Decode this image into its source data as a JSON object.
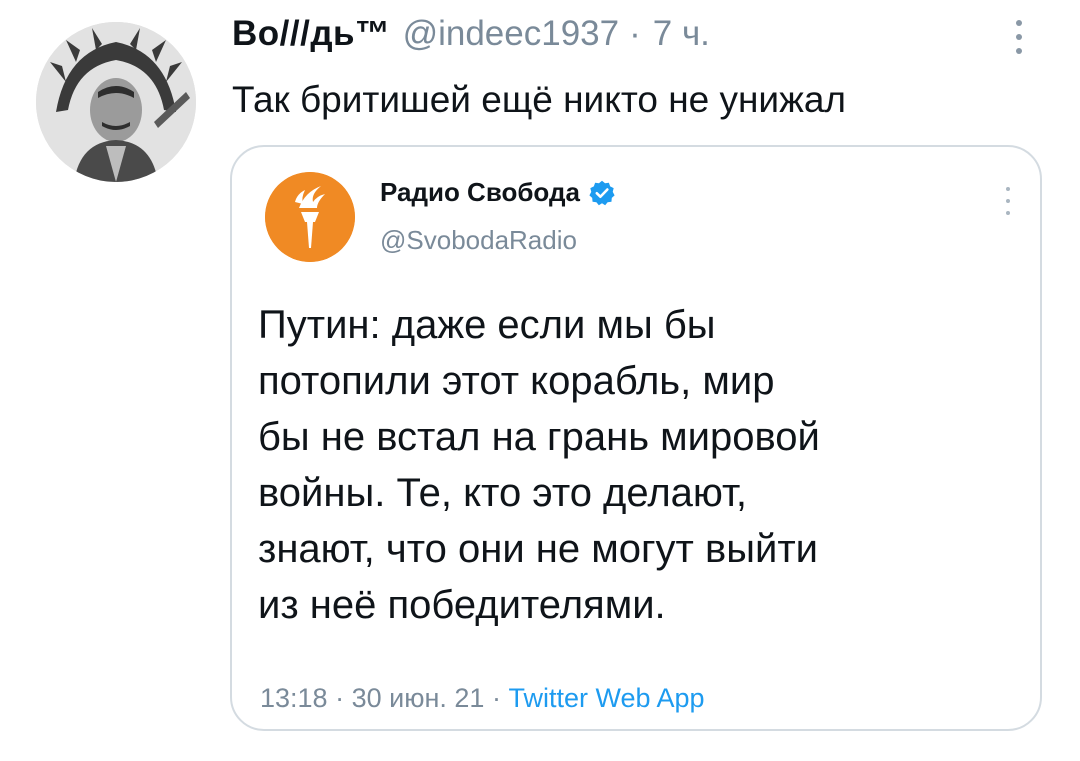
{
  "tweet": {
    "display_name": "Bo///дь™",
    "handle": "@indeec1937",
    "separator": "·",
    "time_ago": "7 ч.",
    "text": "Так бритишей ещё никто не унижал",
    "avatar_icon": "portrait-avatar-icon",
    "more_icon": "vertical-dots-icon"
  },
  "quoted": {
    "display_name": "Радио Свобода",
    "handle": "@SvobodaRadio",
    "verified_icon": "verified-badge-icon",
    "avatar_icon": "torch-logo-icon",
    "more_icon": "vertical-dots-icon",
    "text_lines": [
      "Путин: даже если мы бы",
      "потопили этот корабль, мир",
      "бы не встал на грань мировой",
      "войны. Те, кто это делают,",
      "знают, что они не могут выйти",
      "из неё победителями."
    ],
    "time": "13:18",
    "date": "30 июн. 21",
    "separator": "·",
    "source_app": "Twitter Web App"
  },
  "colors": {
    "text": "#0f1419",
    "muted": "#7a8a99",
    "link": "#1d9bf0",
    "brand_orange": "#f08a24",
    "verified": "#1d9bf0",
    "border": "#d4dbe1"
  }
}
